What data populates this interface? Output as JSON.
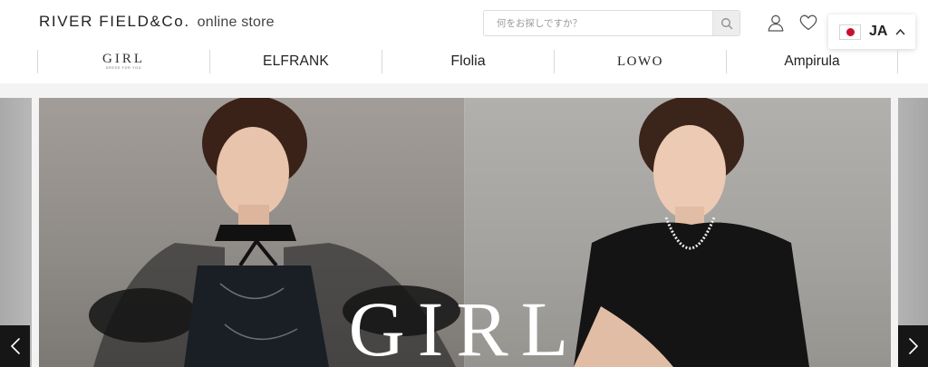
{
  "header": {
    "logo_main": "RIVER FIELD&Co.",
    "logo_sub": "online store",
    "search_placeholder": "何をお探しですか？",
    "icons": {
      "search": "search-icon",
      "account": "user-icon",
      "favorites": "heart-icon",
      "language_toggle": "chevron-up-icon"
    },
    "language": {
      "flag": "japan-flag-icon",
      "code": "JA"
    }
  },
  "brand_nav": {
    "items": [
      {
        "label": "GIRL",
        "sub": "DRESS FOR YOU"
      },
      {
        "label": "ELFRANK"
      },
      {
        "label": "Flolia"
      },
      {
        "label": "LOWO"
      },
      {
        "label": "Ampirula"
      }
    ]
  },
  "hero": {
    "title": "GIRL",
    "prev_icon": "chevron-left-icon",
    "next_icon": "chevron-right-icon"
  },
  "colors": {
    "text": "#222222",
    "band": "#f3f3f3",
    "flag_red": "#c8102e",
    "arrow_bg": "#161616"
  }
}
